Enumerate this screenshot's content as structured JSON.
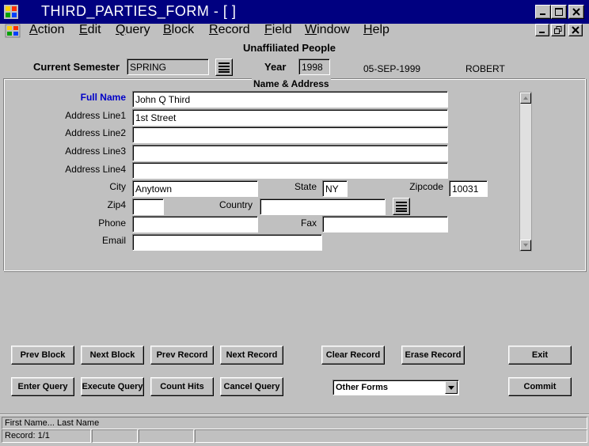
{
  "window": {
    "title": "THIRD_PARTIES_FORM - [ ]"
  },
  "menu": {
    "items": [
      {
        "label": "Action",
        "key": "A",
        "rest": "ction"
      },
      {
        "label": "Edit",
        "key": "E",
        "rest": "dit"
      },
      {
        "label": "Query",
        "key": "Q",
        "rest": "uery"
      },
      {
        "label": "Block",
        "key": "B",
        "rest": "lock"
      },
      {
        "label": "Record",
        "key": "R",
        "rest": "ecord"
      },
      {
        "label": "Field",
        "key": "F",
        "rest": "ield"
      },
      {
        "label": "Window",
        "key": "W",
        "rest": "indow"
      },
      {
        "label": "Help",
        "key": "H",
        "rest": "elp"
      }
    ]
  },
  "header": {
    "form_title": "Unaffiliated People",
    "semester_label": "Current Semester",
    "semester_value": "SPRING",
    "year_label": "Year",
    "year_value": "1998",
    "date": "05-SEP-1999",
    "user": "ROBERT"
  },
  "name_address": {
    "section_title": "Name & Address",
    "full_name_label": "Full Name",
    "full_name_value": "John Q Third",
    "address1_label": "Address Line1",
    "address1_value": "1st Street",
    "address2_label": "Address Line2",
    "address2_value": "",
    "address3_label": "Address Line3",
    "address3_value": "",
    "address4_label": "Address Line4",
    "address4_value": "",
    "city_label": "City",
    "city_value": "Anytown",
    "state_label": "State",
    "state_value": "NY",
    "zipcode_label": "Zipcode",
    "zipcode_value": "10031",
    "zip4_label": "Zip4",
    "zip4_value": "",
    "country_label": "Country",
    "country_value": "",
    "phone_label": "Phone",
    "phone_value": "",
    "fax_label": "Fax",
    "fax_value": "",
    "email_label": "Email",
    "email_value": ""
  },
  "buttons": {
    "prev_block": "Prev Block",
    "next_block": "Next Block",
    "prev_record": "Prev Record",
    "next_record": "Next Record",
    "clear_record": "Clear Record",
    "erase_record": "Erase Record",
    "exit": "Exit",
    "enter_query": "Enter Query",
    "execute_query": "Execute Query",
    "count_hits": "Count Hits",
    "cancel_query": "Cancel Query",
    "commit": "Commit"
  },
  "other_forms": {
    "selected": "Other Forms"
  },
  "status": {
    "hint": "First Name... Last Name",
    "record": "Record: 1/1"
  },
  "colors": {
    "title_bar": "#000080",
    "required_label": "#0000c8",
    "face": "#c0c0c0"
  }
}
